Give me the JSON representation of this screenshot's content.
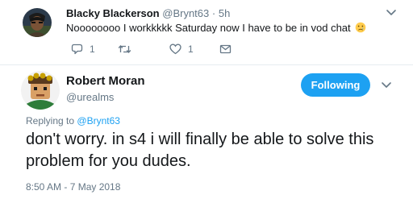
{
  "parent_tweet": {
    "display_name": "Blacky Blackerson",
    "handle": "@Brynt63",
    "separator": "·",
    "time": "5h",
    "text": "Noooooooo I workkkkk Saturday now I have to be in vod chat",
    "emoji": "crying-face-icon",
    "actions": {
      "reply_count": "1",
      "retweet_count": "",
      "like_count": "1"
    }
  },
  "main_tweet": {
    "display_name": "Robert Moran",
    "handle": "@urealms",
    "follow_label": "Following",
    "replying_to_label": "Replying to",
    "replying_to_handle": "@Brynt63",
    "text": "don't worry. in s4 i will finally be able to solve this problem for you dudes.",
    "timestamp": "8:50 AM - 7 May 2018"
  },
  "colors": {
    "accent": "#1da1f2",
    "muted": "#657786",
    "text": "#14171a",
    "divider": "#e6ecf0"
  }
}
